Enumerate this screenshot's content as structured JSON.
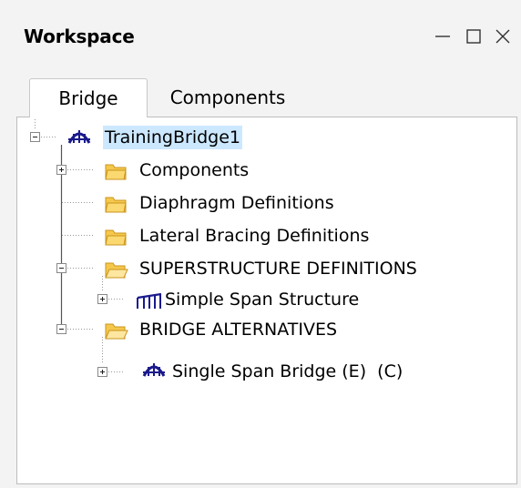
{
  "window": {
    "title": "Workspace",
    "controls": {
      "minimize": "—",
      "maximize": "☐",
      "close": "✕"
    }
  },
  "tabs": [
    {
      "label": "Bridge",
      "active": true
    },
    {
      "label": "Components",
      "active": false
    }
  ],
  "tree": {
    "root": {
      "label": "TrainingBridge1",
      "icon": "bridge-icon",
      "expanded": true,
      "selected": true
    },
    "children": [
      {
        "label": "Components",
        "icon": "folder-icon",
        "expander": "plus"
      },
      {
        "label": "Diaphragm Definitions",
        "icon": "folder-icon",
        "expander": "none"
      },
      {
        "label": "Lateral Bracing Definitions",
        "icon": "folder-icon",
        "expander": "none"
      },
      {
        "label": "SUPERSTRUCTURE DEFINITIONS",
        "icon": "open-folder-icon",
        "expander": "minus",
        "children": [
          {
            "label": "Simple Span Structure",
            "icon": "truss-icon",
            "expander": "plus"
          }
        ]
      },
      {
        "label": "BRIDGE ALTERNATIVES",
        "icon": "open-folder-icon",
        "expander": "minus",
        "children": [
          {
            "label": "Single Span Bridge (E)  (C)",
            "icon": "bridge-icon",
            "expander": "plus"
          }
        ]
      }
    ]
  },
  "colors": {
    "selection": "#cce8ff",
    "folder_fill": "#f5c84c",
    "bridge_icon": "#1a1a8c",
    "truss_icon": "#1a1a8c"
  }
}
